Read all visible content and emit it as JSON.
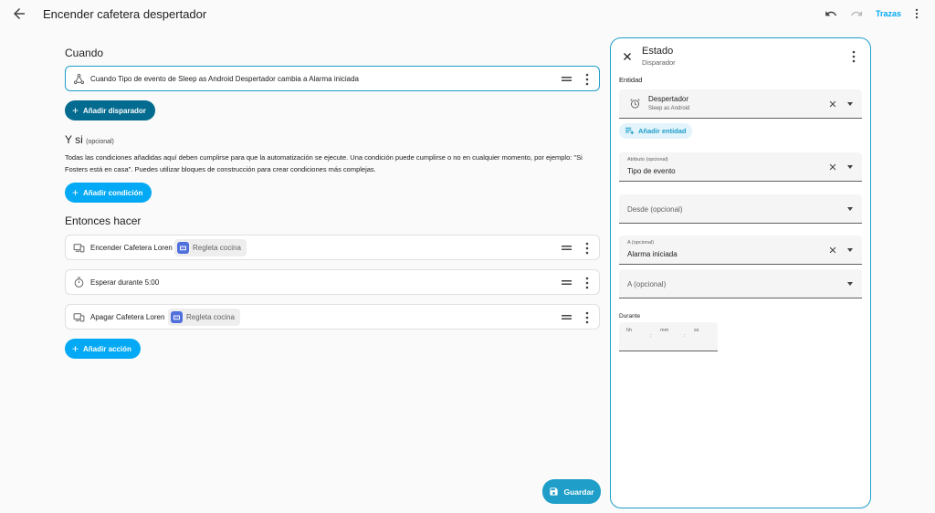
{
  "topbar": {
    "title": "Encender cafetera despertador",
    "traces_label": "Trazas"
  },
  "when": {
    "title": "Cuando",
    "trigger_text": "Cuando Tipo de evento de Sleep as Android Despertador cambia a Alarma iniciada",
    "add_trigger_label": "Añadir disparador"
  },
  "conditions": {
    "title": "Y si",
    "optional": "(opcional)",
    "description": "Todas las condiciones añadidas aquí deben cumplirse para que la automatización se ejecute. Una condición puede cumplirse o no en cualquier momento, por ejemplo: \"Si Fosters está en casa\". Puedes utilizar bloques de construcción para crear condiciones más complejas.",
    "add_condition_label": "Añadir condición"
  },
  "actions": {
    "title": "Entonces hacer",
    "items": [
      {
        "text": "Encender Cafetera Loren",
        "chip": "Regleta cocina"
      },
      {
        "text": "Esperar durante 5:00"
      },
      {
        "text": "Apagar Cafetera Loren",
        "chip": "Regleta cocina"
      }
    ],
    "add_action_label": "Añadir acción"
  },
  "save_label": "Guardar",
  "panel": {
    "title": "Estado",
    "subtitle": "Disparador",
    "entity_label": "Entidad",
    "entity": {
      "name": "Despertador",
      "sub": "Sleep as Android"
    },
    "add_entity_label": "Añadir entidad",
    "attribute": {
      "label": "Atributo (opcional)",
      "value": "Tipo de evento"
    },
    "from": {
      "placeholder": "Desde (opcional)"
    },
    "to_filled": {
      "label": "A (opcional)",
      "value": "Alarma iniciada"
    },
    "to_empty": {
      "placeholder": "A (opcional)"
    },
    "duration_label": "Durante",
    "duration": {
      "hh": "hh",
      "mm": "mm",
      "ss": "ss",
      "sep": ":"
    }
  },
  "colors": {
    "accent": "#03a9f4",
    "accent_dark": "#036b8f",
    "border_selected": "#1e9ec8"
  }
}
